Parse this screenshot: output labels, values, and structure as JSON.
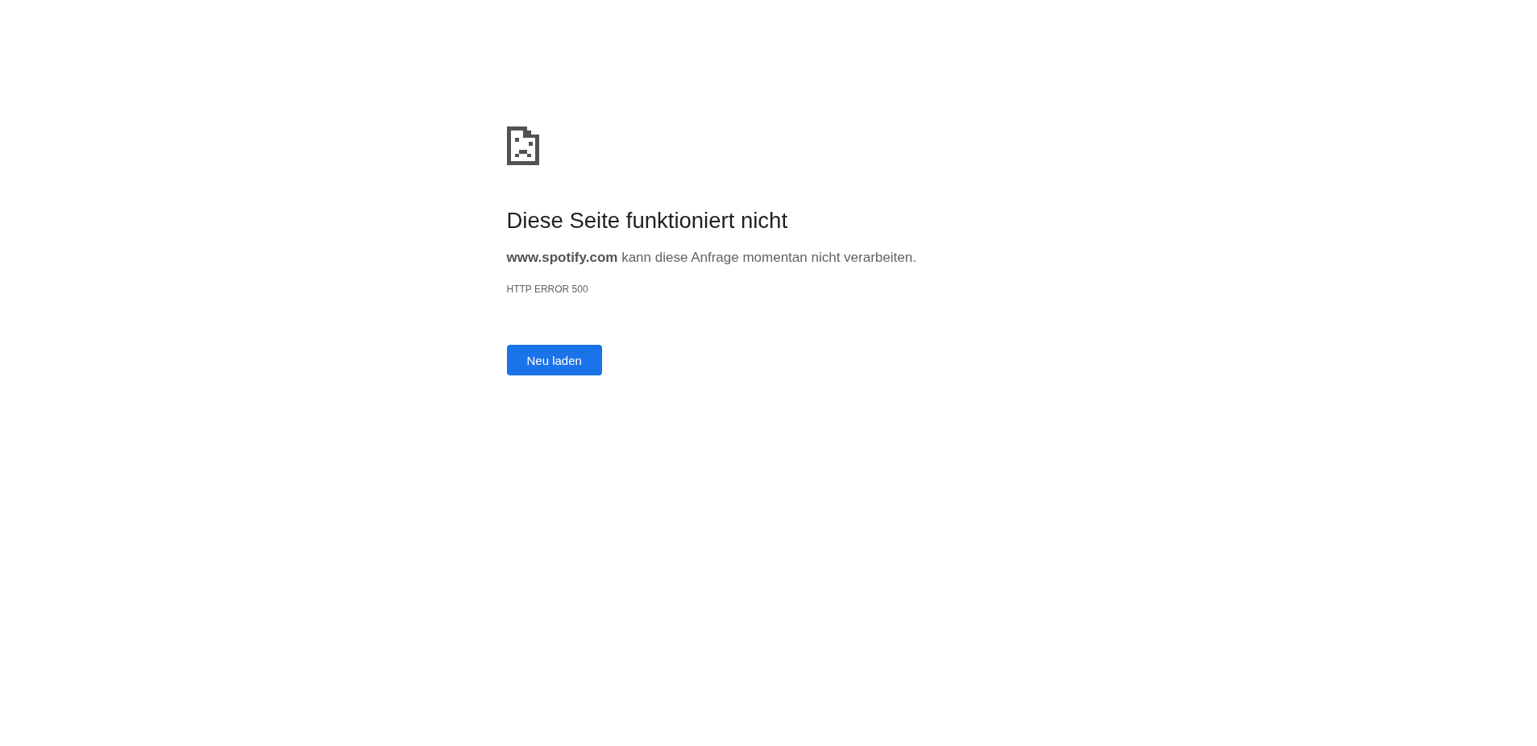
{
  "heading": "Diese Seite funktioniert nicht",
  "message": "**www.spotify.com** kann diese Anfrage momentan nicht verarbeiten.",
  "error_code": "HTTP ERROR 500",
  "reload_button": {
    "label": "Neu laden"
  }
}
